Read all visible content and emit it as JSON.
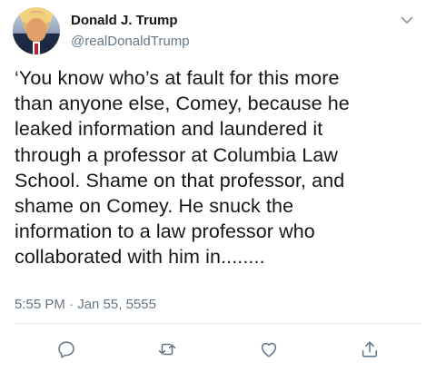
{
  "tweet": {
    "author_name": "Donald J. Trump",
    "author_handle": "@realDonaldTrump",
    "text": "‘You know who’s at fault for this more\nthan anyone else, Comey, because he\nleaked information and laundered it\nthrough a professor at Columbia Law\nSchool. Shame on that professor, and\nshame on Comey. He snuck the\ninformation to a law professor who\ncollaborated with him in........",
    "timestamp": "5:55 PM · Jan 55, 5555"
  },
  "icons": {
    "menu": "chevron-down-icon",
    "reply": "reply-icon",
    "retweet": "retweet-icon",
    "like": "heart-icon",
    "share": "share-icon"
  },
  "colors": {
    "text_primary": "#14171a",
    "text_secondary": "#657786",
    "icon": "#657786",
    "divider": "#e6ecf0"
  }
}
